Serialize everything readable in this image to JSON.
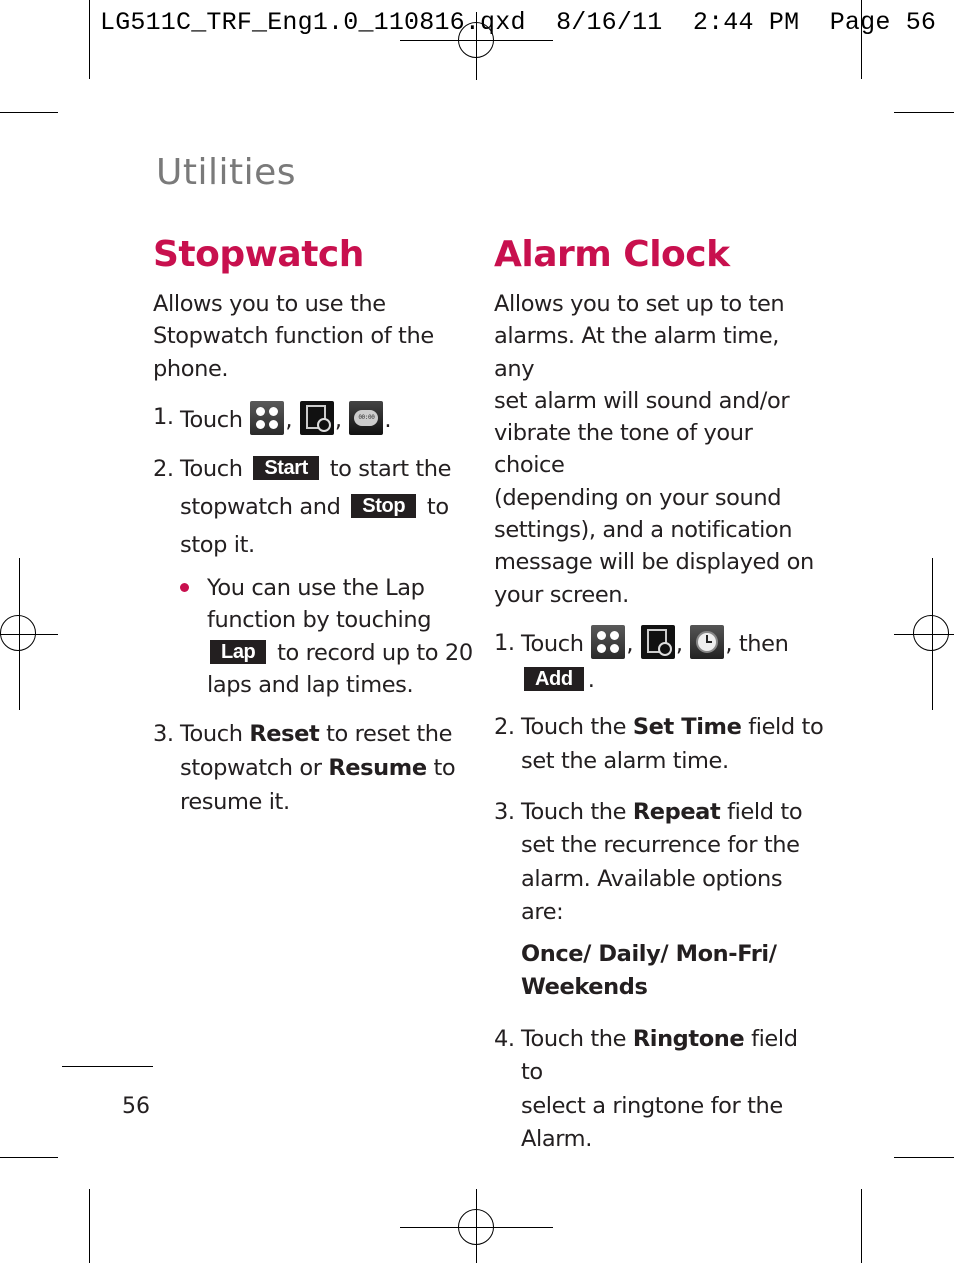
{
  "slug": "LG511C_TRF_Eng1.0_110816.qxd  8/16/11  2:44 PM  Page 56",
  "section_title": "Utilities",
  "accent_color": "#c8104e",
  "stopwatch": {
    "heading": "Stopwatch",
    "intro": [
      "Allows you to use the",
      "Stopwatch function of the",
      "phone."
    ],
    "step1": {
      "num": "1.",
      "text": "Touch",
      "icons": [
        "menu-icon",
        "tools-icon",
        "stopwatch-icon"
      ]
    },
    "step2": {
      "num": "2.",
      "pre": "Touch",
      "btn_start": "Start",
      "mid1": "to start the",
      "mid2": "stopwatch and",
      "btn_stop": "Stop",
      "post1": "to",
      "post2": "stop it."
    },
    "bullet": {
      "l1": "You can use the Lap",
      "l2": "function by touching",
      "btn_lap": "Lap",
      "l3": "to record up to 20",
      "l4": "laps and lap times."
    },
    "step3": {
      "num": "3.",
      "pre": "Touch",
      "bold1": "Reset",
      "mid": "to reset the",
      "l2pre": "stopwatch or",
      "bold2": "Resume",
      "l2post": "to",
      "l3": "resume it."
    }
  },
  "alarm": {
    "heading": "Alarm Clock",
    "intro": [
      "Allows you to set up to ten",
      "alarms. At the alarm time, any",
      "set alarm will sound and/or",
      "vibrate the tone of your choice",
      "(depending on your sound",
      "settings), and a notification",
      "message will be displayed on",
      "your screen."
    ],
    "step1": {
      "num": "1.",
      "text": "Touch",
      "then": ", then",
      "btn_add": "Add",
      "icons": [
        "menu-icon",
        "tools-icon",
        "alarm-clock-icon"
      ]
    },
    "step2": {
      "num": "2.",
      "pre": "Touch the",
      "bold": "Set Time",
      "post": "field to",
      "l2": "set the alarm time."
    },
    "step3": {
      "num": "3.",
      "pre": "Touch the",
      "bold": "Repeat",
      "post": "field to",
      "l2": "set the recurrence for the",
      "l3": "alarm. Available options are:",
      "options1": "Once/ Daily/ Mon-Fri/",
      "options2": "Weekends"
    },
    "step4": {
      "num": "4.",
      "pre": "Touch the",
      "bold": "Ringtone",
      "post": "field to",
      "l2": "select a ringtone for the",
      "l3": "Alarm."
    }
  },
  "page_number": "56"
}
